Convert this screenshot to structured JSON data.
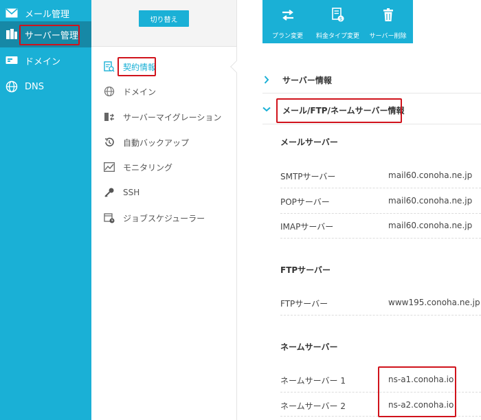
{
  "nav": {
    "items": [
      {
        "label": "メール管理",
        "icon": "mail-icon"
      },
      {
        "label": "サーバー管理",
        "icon": "server-icon"
      },
      {
        "label": "ドメイン",
        "icon": "domain-icon"
      },
      {
        "label": "DNS",
        "icon": "globe-icon"
      }
    ]
  },
  "submenu": {
    "switch_label": "切り替え",
    "items": [
      {
        "label": "契約情報",
        "icon": "contract-icon"
      },
      {
        "label": "ドメイン",
        "icon": "globe-icon"
      },
      {
        "label": "サーバーマイグレーション",
        "icon": "migration-icon"
      },
      {
        "label": "自動バックアップ",
        "icon": "backup-icon"
      },
      {
        "label": "モニタリング",
        "icon": "monitoring-icon"
      },
      {
        "label": "SSH",
        "icon": "key-icon"
      },
      {
        "label": "ジョブスケジューラー",
        "icon": "scheduler-icon"
      }
    ]
  },
  "toolbar": {
    "plan_change": "プラン変更",
    "price_type_change": "料金タイプ変更",
    "server_delete": "サーバー削除"
  },
  "sections": {
    "server_info": "サーバー情報",
    "mail_ftp_ns_info": "メール/FTP/ネームサーバー情報"
  },
  "mail": {
    "title": "メールサーバー",
    "rows": [
      {
        "label": "SMTPサーバー",
        "value": "mail60.conoha.ne.jp"
      },
      {
        "label": "POPサーバー",
        "value": "mail60.conoha.ne.jp"
      },
      {
        "label": "IMAPサーバー",
        "value": "mail60.conoha.ne.jp"
      }
    ]
  },
  "ftp": {
    "title": "FTPサーバー",
    "rows": [
      {
        "label": "FTPサーバー",
        "value": "www195.conoha.ne.jp"
      }
    ]
  },
  "nameserver": {
    "title": "ネームサーバー",
    "rows": [
      {
        "label": "ネームサーバー 1",
        "value": "ns-a1.conoha.io"
      },
      {
        "label": "ネームサーバー 2",
        "value": "ns-a2.conoha.io"
      }
    ]
  },
  "colors": {
    "accent": "#1ab0d6",
    "highlight": "#d0121b"
  }
}
